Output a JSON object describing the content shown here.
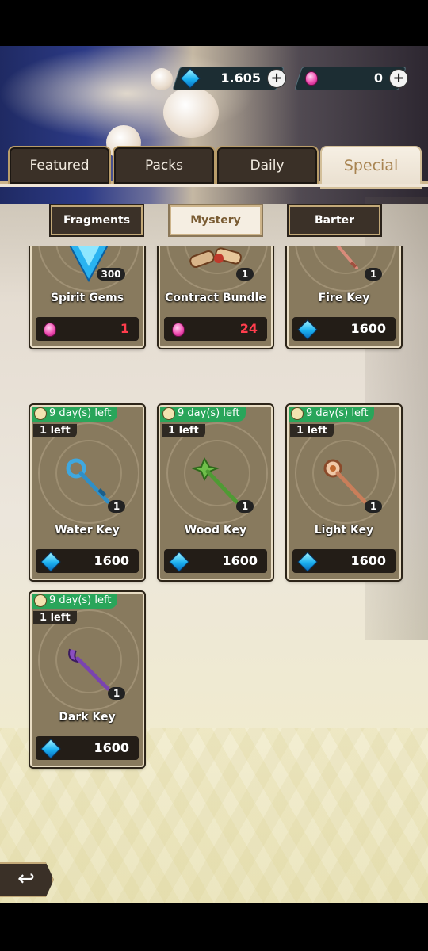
{
  "currency": {
    "diamonds": {
      "icon": "diamond-icon",
      "value": "1.605"
    },
    "rubies": {
      "icon": "pink-gem-icon",
      "value": "0"
    }
  },
  "tabs": [
    {
      "label": "Featured",
      "active": false
    },
    {
      "label": "Packs",
      "active": false
    },
    {
      "label": "Daily",
      "active": false
    },
    {
      "label": "Special",
      "active": true
    }
  ],
  "subtabs": [
    {
      "label": "Fragments",
      "active": false
    },
    {
      "label": "Mystery",
      "active": true
    },
    {
      "label": "Barter",
      "active": false
    }
  ],
  "items": [
    {
      "name": "Spirit Gems",
      "qty": "300",
      "price": "1",
      "price_currency": "pink-gem",
      "timer": "",
      "left": ""
    },
    {
      "name": "Contract Bundle",
      "qty": "1",
      "price": "24",
      "price_currency": "pink-gem",
      "timer": "",
      "left": ""
    },
    {
      "name": "Fire Key",
      "qty": "1",
      "price": "1600",
      "price_currency": "diamond",
      "timer": "",
      "left": ""
    },
    {
      "name": "Water Key",
      "qty": "1",
      "price": "1600",
      "price_currency": "diamond",
      "timer": "9 day(s) left",
      "left": "1 left"
    },
    {
      "name": "Wood Key",
      "qty": "1",
      "price": "1600",
      "price_currency": "diamond",
      "timer": "9 day(s) left",
      "left": "1 left"
    },
    {
      "name": "Light Key",
      "qty": "1",
      "price": "1600",
      "price_currency": "diamond",
      "timer": "9 day(s) left",
      "left": "1 left"
    },
    {
      "name": "Dark Key",
      "qty": "1",
      "price": "1600",
      "price_currency": "diamond",
      "timer": "9 day(s) left",
      "left": "1 left"
    }
  ],
  "colors": {
    "accent": "#a88451",
    "timer_green": "#29a55a",
    "price_red": "#ff3d4d"
  },
  "back_button": {
    "icon": "back-arrow-icon",
    "glyph": "↩"
  }
}
